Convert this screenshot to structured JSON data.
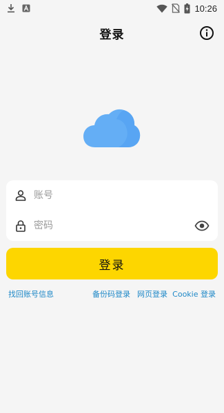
{
  "status_bar": {
    "time": "10:26",
    "left_icons": [
      "download-icon",
      "a-notification-icon"
    ],
    "right_icons": [
      "wifi-icon",
      "no-sim-icon",
      "battery-charging-icon"
    ]
  },
  "header": {
    "title": "登录",
    "info_icon": "info-icon"
  },
  "logo": {
    "icon": "cloud-icon",
    "color": "#64aef5"
  },
  "form": {
    "account": {
      "placeholder": "账号",
      "value": "",
      "icon": "person-icon"
    },
    "password": {
      "placeholder": "密码",
      "value": "",
      "icon": "lock-icon",
      "toggle_icon": "eye-icon"
    }
  },
  "login_button": {
    "label": "登录",
    "color": "#fdd600"
  },
  "links": {
    "recover": "找回账号信息",
    "backup_code_login": "备份码登录",
    "web_login": "网页登录",
    "cookie_login": "Cookie 登录",
    "color": "#1e88c7"
  }
}
